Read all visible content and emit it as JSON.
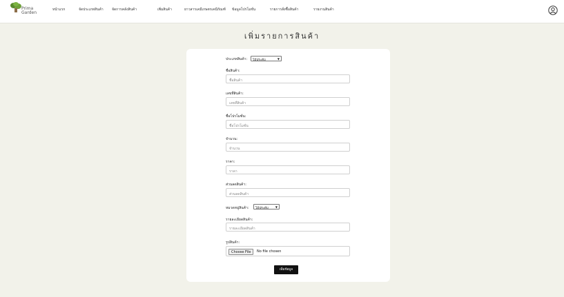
{
  "brand": {
    "name_line1": "Prima",
    "name_line2": "Garden"
  },
  "nav": [
    {
      "label": "หน้าแรก"
    },
    {
      "label": "จัดประเภทสินค้า"
    },
    {
      "label": "จัดการคลังสินค้า"
    },
    {
      "label": "เพิ่มสินค้า"
    },
    {
      "label": "ยาวสารเคมีเกษตรเคมีภัณฑ์"
    },
    {
      "label": "ข้อมูลโปรโมชั่น"
    },
    {
      "label": "รายการสั่งซื้อสินค้า"
    },
    {
      "label": "รายงานสินค้า"
    }
  ],
  "page_title": "เพิ่มรายการสินค้า",
  "form": {
    "category": {
      "label": "ประเภทสินค้า:",
      "value": "ไม้ประดับ"
    },
    "name": {
      "label": "ชื่อสินค้า:",
      "placeholder": "ชื่อสินค้า"
    },
    "code": {
      "label": "เลขที่สินค้า:",
      "placeholder": "เลขที่สินค้า"
    },
    "promo": {
      "label": "ชื่อโปรโมชั่น:",
      "placeholder": "ชื่อโปรโมชั่น"
    },
    "qty": {
      "label": "จำนวน:",
      "placeholder": "จำนวน"
    },
    "price": {
      "label": "ราคา:",
      "placeholder": "ราคา"
    },
    "discount": {
      "label": "ส่วนลดสินค้า:",
      "placeholder": "ส่วนลดสินค้า"
    },
    "group": {
      "label": "หมวดหมู่สินค้า:",
      "value": "ไม้ประดับ"
    },
    "detail": {
      "label": "รายละเอียดสินค้า:",
      "placeholder": "รายละเอียดสินค้า"
    },
    "image": {
      "label": "รูปสินค้า:",
      "button": "Choose File",
      "status": "No file chosen"
    },
    "submit": "เพิ่มข้อมูล"
  },
  "colors": {
    "page_bg": "#f2f2ea",
    "card_bg": "#ffffff",
    "button_bg": "#111111",
    "logo_green": "#5a8a2e"
  },
  "icons": {
    "logo": "plant-logo-icon",
    "user": "user-circle-icon",
    "dropdown": "chevron-down-icon"
  }
}
